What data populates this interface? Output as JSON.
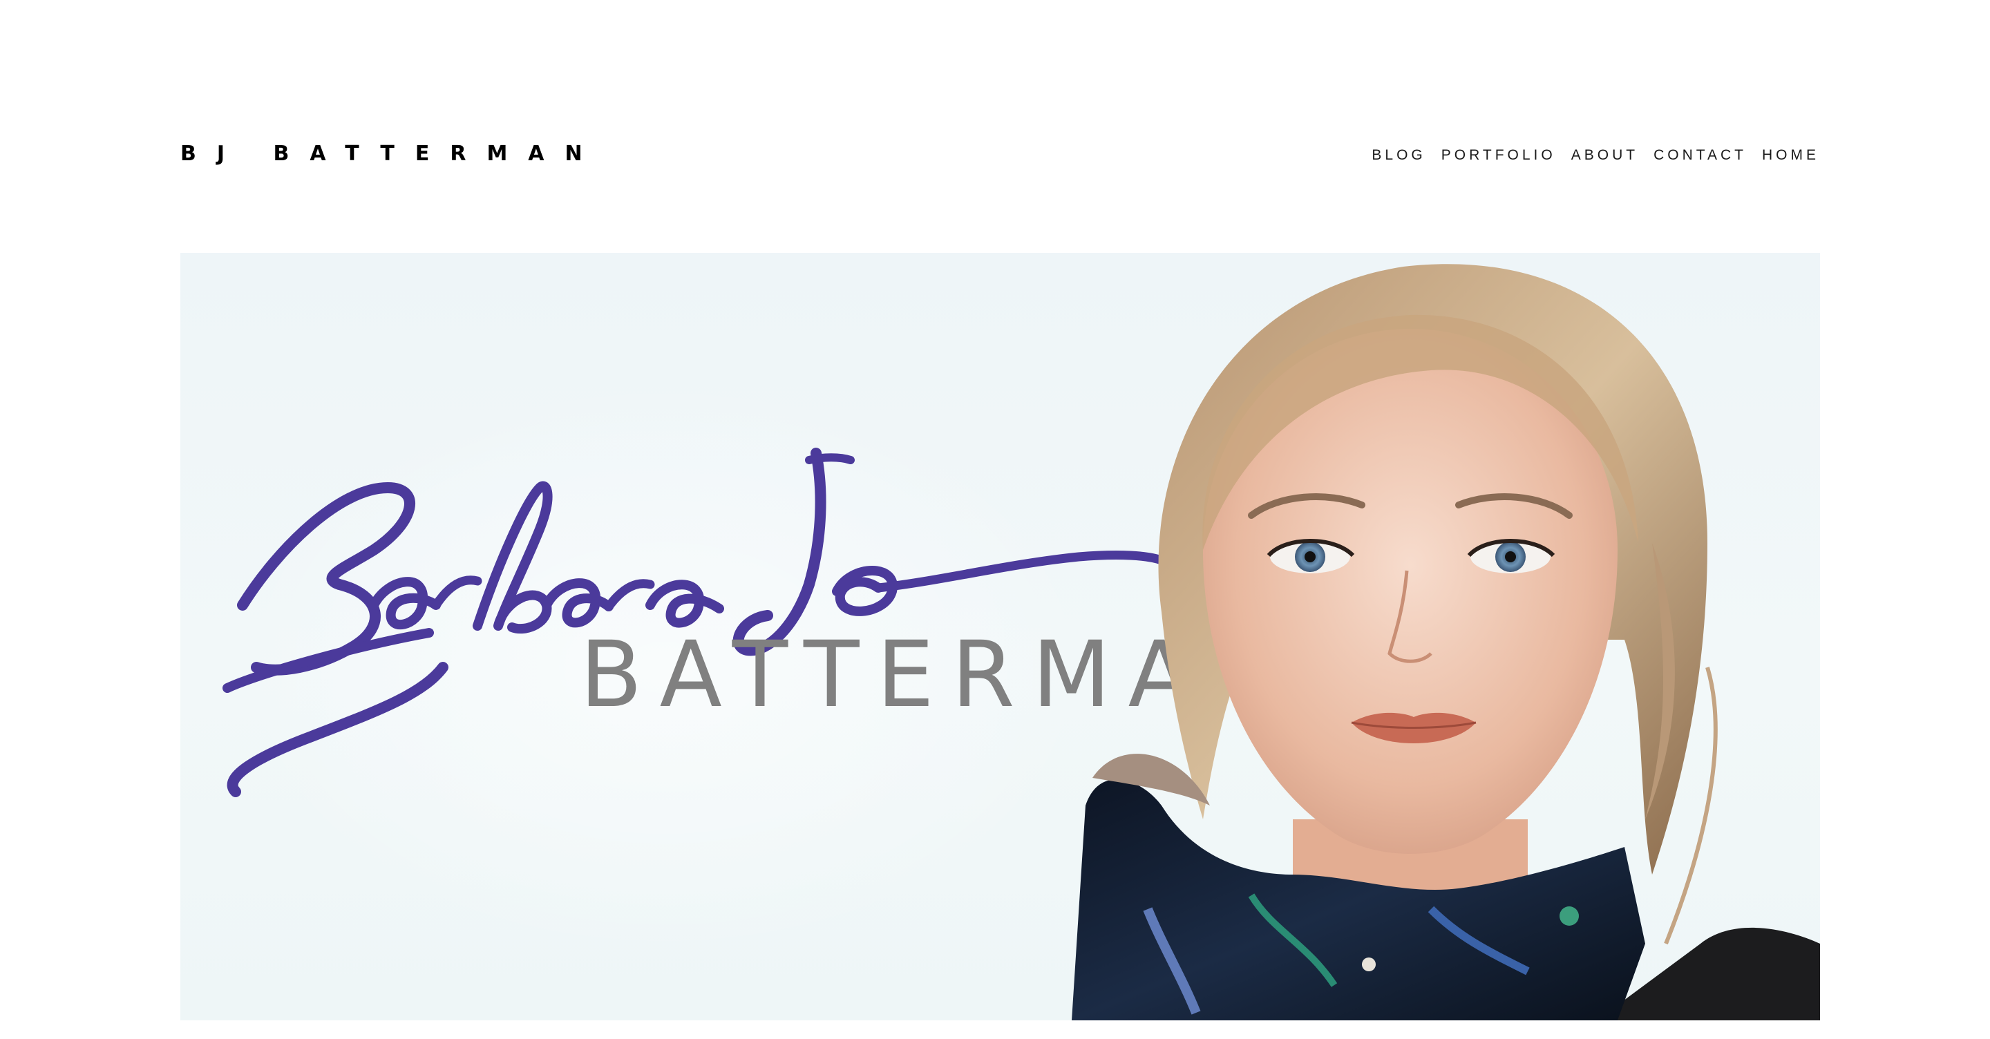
{
  "site": {
    "title": "BJ BATTERMAN"
  },
  "nav": {
    "items": [
      {
        "label": "BLOG"
      },
      {
        "label": "PORTFOLIO"
      },
      {
        "label": "ABOUT"
      },
      {
        "label": "CONTACT"
      },
      {
        "label": "HOME"
      }
    ]
  },
  "hero": {
    "signature_text": "Barbara Jo",
    "subname": "BATTERMAN",
    "colors": {
      "signature": "#4b3a9b",
      "subname": "#808080",
      "background": "#eef5f8"
    }
  }
}
